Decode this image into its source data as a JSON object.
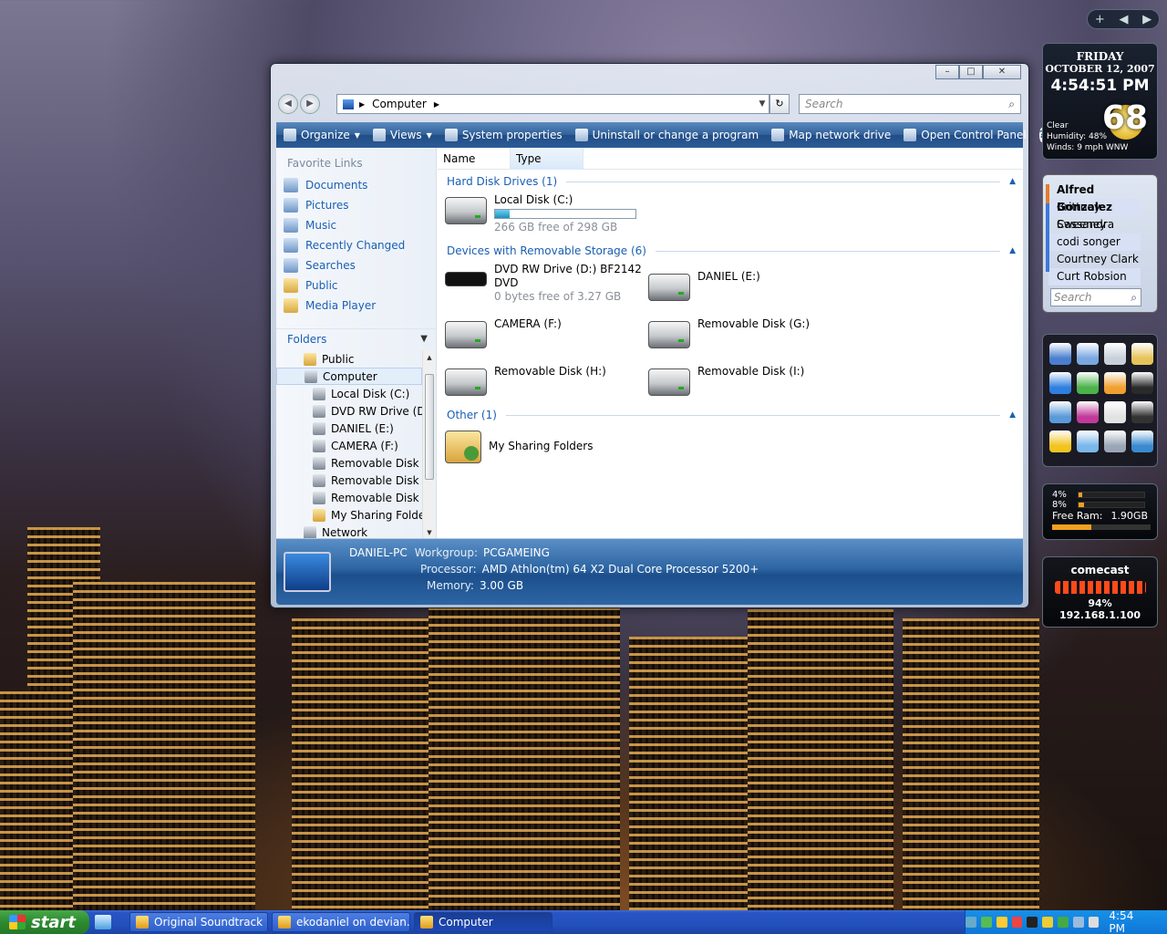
{
  "window": {
    "address": {
      "path_label": "Computer"
    },
    "search_placeholder": "Search",
    "toolbar": [
      {
        "label": "Organize",
        "menu": true,
        "name": "organize-button"
      },
      {
        "label": "Views",
        "menu": true,
        "name": "views-button"
      },
      {
        "label": "System properties",
        "menu": false,
        "name": "system-properties-button"
      },
      {
        "label": "Uninstall or change a program",
        "menu": false,
        "name": "uninstall-program-button"
      },
      {
        "label": "Map network drive",
        "menu": false,
        "name": "map-network-drive-button"
      },
      {
        "label": "Open Control Panel",
        "menu": false,
        "name": "open-control-panel-button"
      }
    ],
    "help_label": "?",
    "favorite_links": {
      "heading": "Favorite Links",
      "items": [
        "Documents",
        "Pictures",
        "Music",
        "Recently Changed",
        "Searches",
        "Public",
        "Media Player"
      ]
    },
    "folders": {
      "heading": "Folders",
      "items": [
        {
          "label": "Public",
          "indent": 1,
          "kind": "folder"
        },
        {
          "label": "Computer",
          "indent": 1,
          "kind": "computer",
          "selected": true
        },
        {
          "label": "Local Disk (C:)",
          "indent": 2,
          "kind": "drive"
        },
        {
          "label": "DVD RW Drive (D:)",
          "indent": 2,
          "kind": "drive"
        },
        {
          "label": "DANIEL (E:)",
          "indent": 2,
          "kind": "drive"
        },
        {
          "label": "CAMERA (F:)",
          "indent": 2,
          "kind": "drive"
        },
        {
          "label": "Removable Disk (G:)",
          "indent": 2,
          "kind": "drive"
        },
        {
          "label": "Removable Disk (H:)",
          "indent": 2,
          "kind": "drive"
        },
        {
          "label": "Removable Disk (I:)",
          "indent": 2,
          "kind": "drive"
        },
        {
          "label": "My Sharing Folders",
          "indent": 2,
          "kind": "share"
        },
        {
          "label": "Network",
          "indent": 1,
          "kind": "network"
        }
      ]
    },
    "columns": [
      "Name",
      "Type"
    ],
    "groups": [
      {
        "title": "Hard Disk Drives (1)"
      },
      {
        "title": "Devices with Removable Storage (6)"
      },
      {
        "title": "Other (1)"
      }
    ],
    "drives": {
      "c": {
        "name": "Local Disk (C:)",
        "free": "266 GB free of 298 GB",
        "used_fraction": 0.107
      },
      "d": {
        "name": "DVD RW Drive (D:) BF2142",
        "name2": "DVD",
        "free": "0 bytes free of 3.27 GB"
      },
      "e": {
        "name": "DANIEL (E:)"
      },
      "f": {
        "name": "CAMERA (F:)"
      },
      "g": {
        "name": "Removable Disk (G:)"
      },
      "h": {
        "name": "Removable Disk (H:)"
      },
      "i": {
        "name": "Removable Disk (I:)"
      },
      "share": {
        "name": "My Sharing Folders"
      }
    },
    "details": {
      "pc_name": "DANIEL-PC",
      "workgroup_label": "Workgroup:",
      "workgroup": "PCGAMEING",
      "processor_label": "Processor:",
      "processor": "AMD Athlon(tm) 64 X2 Dual Core Processor 5200+",
      "memory_label": "Memory:",
      "memory": "3.00 GB"
    }
  },
  "sidebar": {
    "nav_add": "+",
    "clock": {
      "day": "FRIDAY",
      "date": "OCTOBER 12, 2007",
      "time": "4:54:51 PM"
    },
    "weather": {
      "temp": "68",
      "condition": "Clear",
      "humidity": "Humidity: 48%",
      "winds": "Winds: 9 mph WNW"
    },
    "contacts": {
      "items": [
        "Alfred Gonzalez",
        "Brittney Sweeney",
        "Cassandra",
        "codi songer",
        "Courtney Clark",
        "Curt Robsion"
      ],
      "search_placeholder": "Search"
    },
    "meter": {
      "cpu1": "4%",
      "cpu1_value": 0.04,
      "cpu2": "8%",
      "cpu2_value": 0.08,
      "ram_label": "Free Ram:",
      "ram": "1.90GB"
    },
    "network": {
      "name": "comecast",
      "signal": "94%",
      "ip": "192.168.1.100"
    }
  },
  "taskbar": {
    "start": "start",
    "buttons": [
      {
        "label": "Original Soundtrack"
      },
      {
        "label": "ekodaniel on devian..."
      },
      {
        "label": "Computer",
        "active": true
      }
    ],
    "clock": "4:54 PM"
  },
  "colors": {
    "explorer_toolbar": "#2f5f99",
    "link_blue": "#1a5fb4",
    "taskbar": "#2250bd",
    "accent_orange": "#f0a020"
  },
  "icons": [
    "search-icon",
    "refresh-icon",
    "help-icon",
    "hard-disk-icon",
    "removable-drive-icon",
    "computer-icon",
    "folder-icon"
  ]
}
